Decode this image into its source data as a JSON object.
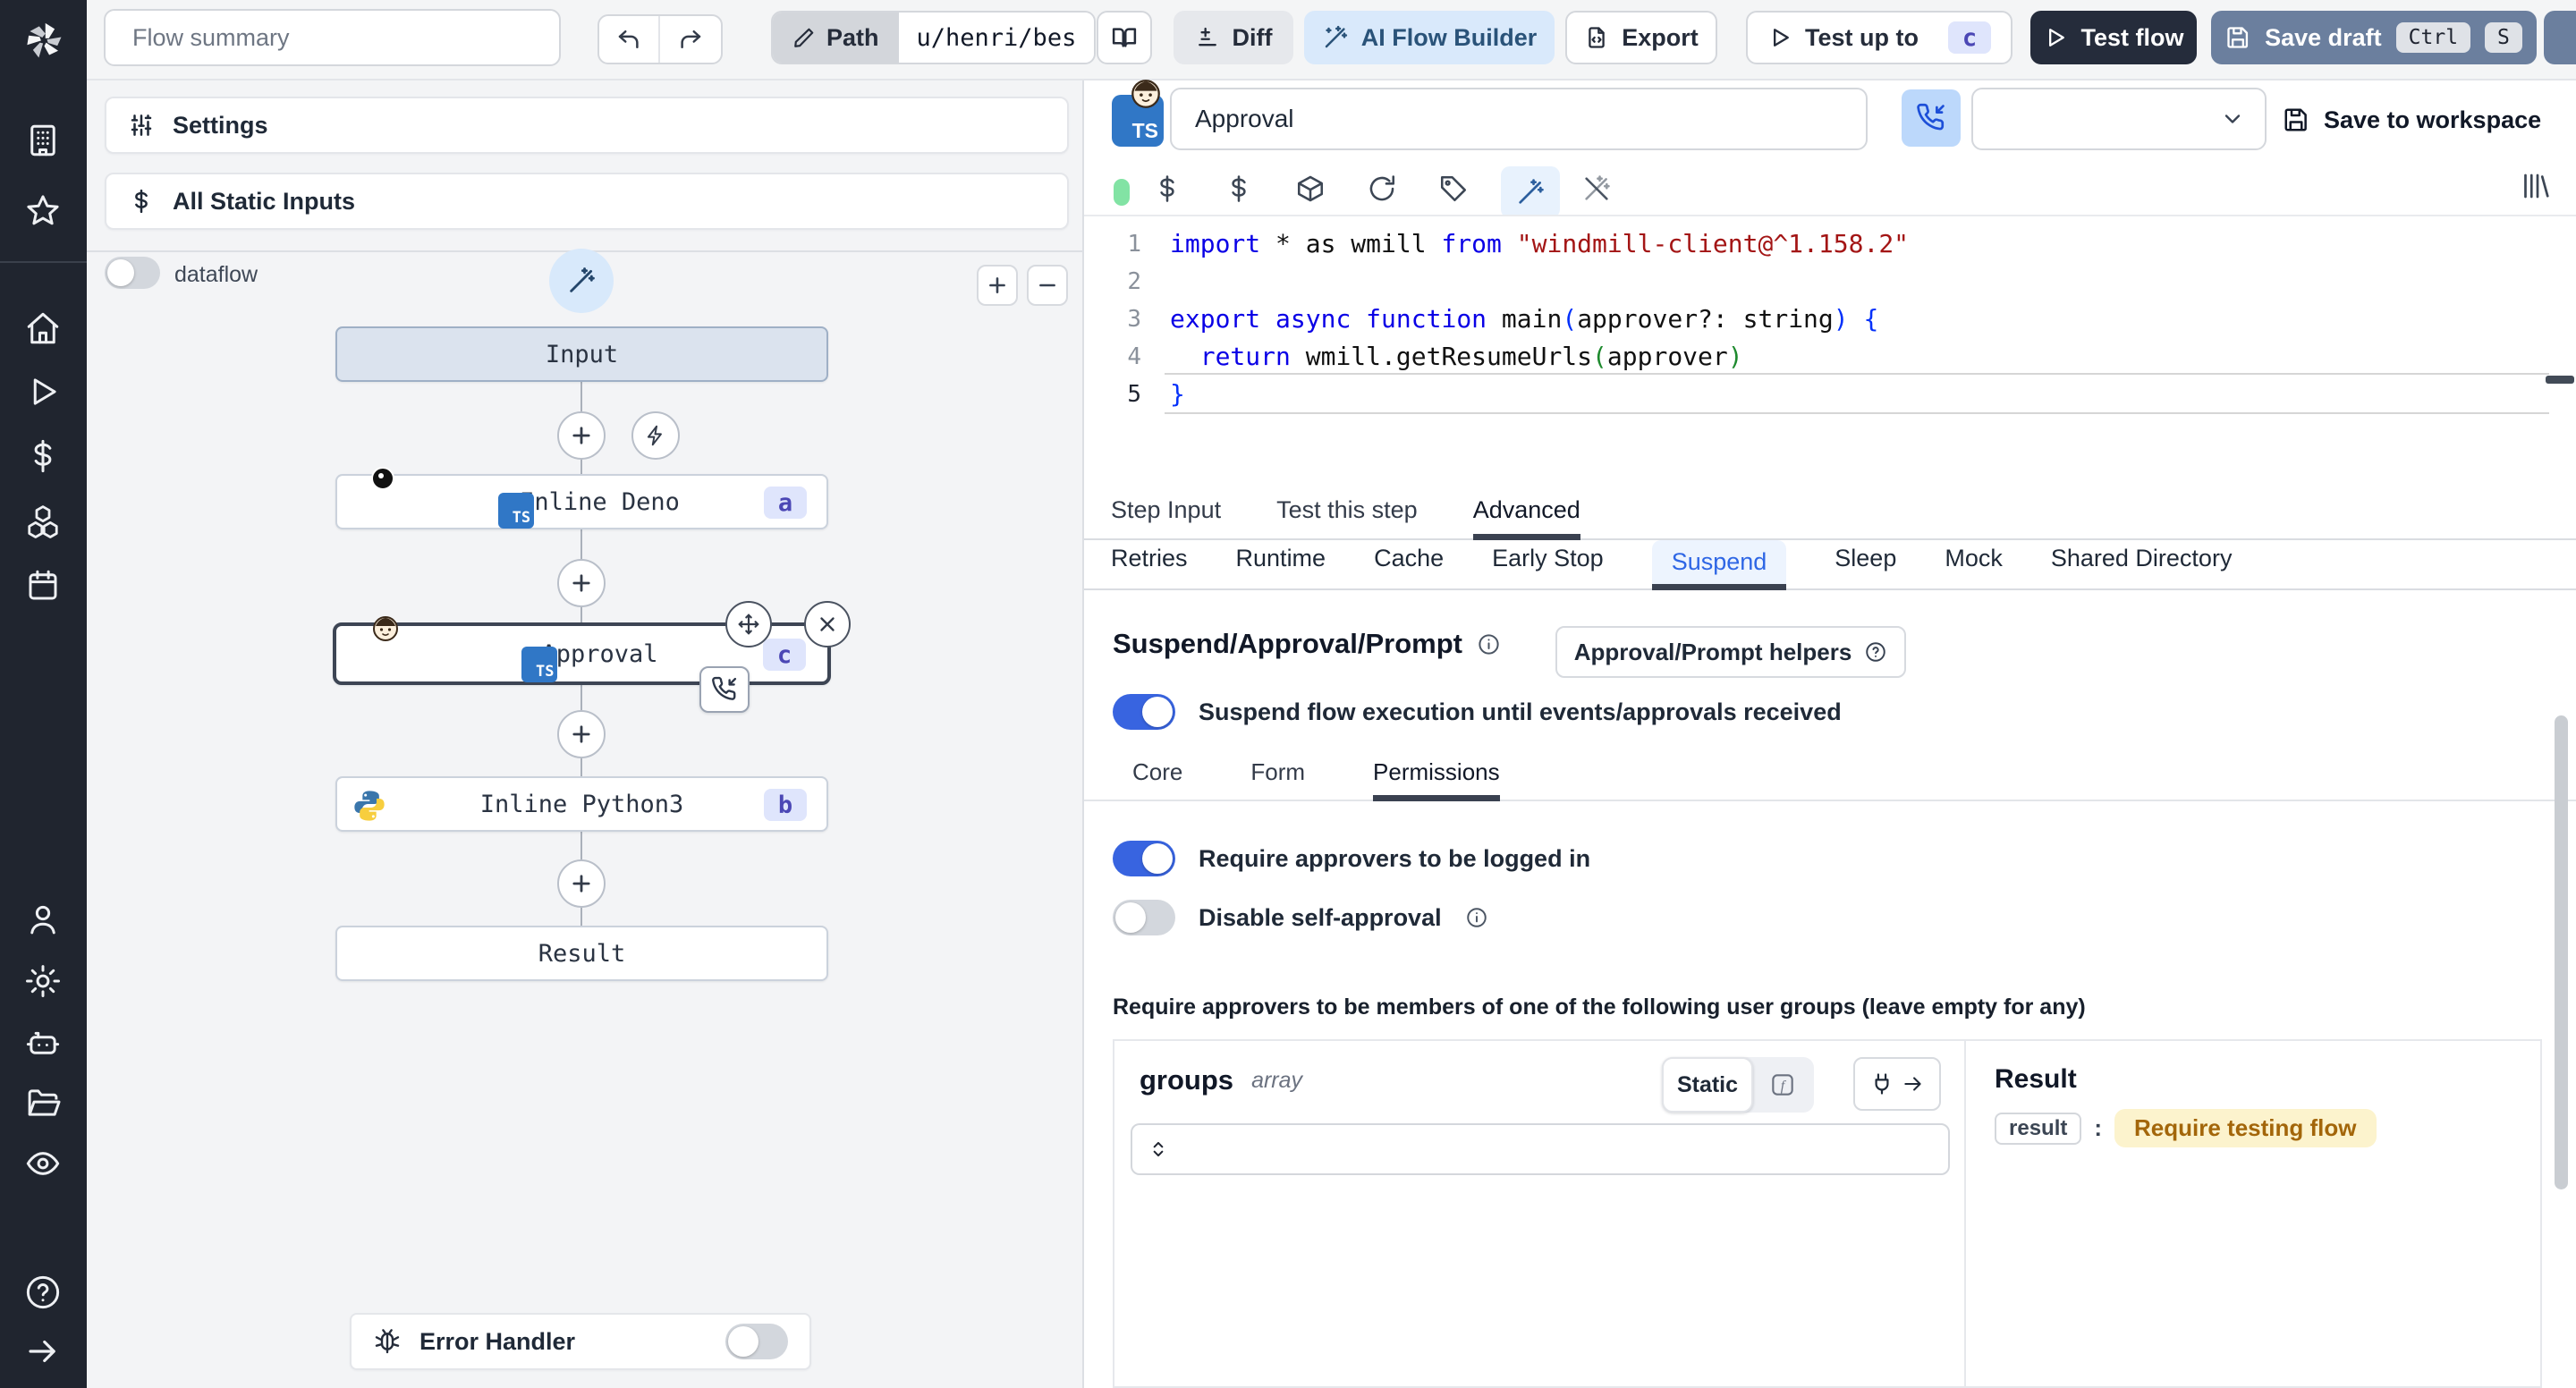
{
  "topbar": {
    "flow_summary_placeholder": "Flow summary",
    "path_label": "Path",
    "path_value": "u/henri/bes",
    "diff_label": "Diff",
    "ai_builder_label": "AI Flow Builder",
    "export_label": "Export",
    "test_up_to_label": "Test up to",
    "test_up_to_badge": "c",
    "test_flow_label": "Test flow",
    "save_draft_label": "Save draft",
    "save_kbd_1": "Ctrl",
    "save_kbd_2": "S"
  },
  "sidebar": {
    "icons": [
      "workspace",
      "favorites",
      "home",
      "runs",
      "variables",
      "resources",
      "schedules",
      "users",
      "settings",
      "workers",
      "folders",
      "audit-logs",
      "help",
      "expand"
    ]
  },
  "flow": {
    "settings_label": "Settings",
    "static_inputs_label": "All Static Inputs",
    "dataflow_label": "dataflow",
    "nodes": {
      "input": "Input",
      "deno": {
        "label": "Inline Deno",
        "badge": "a"
      },
      "approval": {
        "label": "Approval",
        "badge": "c"
      },
      "python": {
        "label": "Inline Python3",
        "badge": "b"
      },
      "result": "Result"
    },
    "error_handler_label": "Error Handler"
  },
  "step": {
    "title_value": "Approval",
    "save_to_workspace_label": "Save to workspace"
  },
  "editor": {
    "active_line": 5,
    "lines": [
      [
        [
          "kw",
          "import"
        ],
        [
          "pl",
          " * as wmill "
        ],
        [
          "kw",
          "from"
        ],
        [
          "pl",
          " "
        ],
        [
          "str",
          "\"windmill-client@^1.158.2\""
        ]
      ],
      [],
      [
        [
          "kw",
          "export"
        ],
        [
          "pl",
          " "
        ],
        [
          "kw",
          "async"
        ],
        [
          "pl",
          " "
        ],
        [
          "kw",
          "function"
        ],
        [
          "pl",
          " main"
        ],
        [
          "p1",
          "("
        ],
        [
          "pl",
          "approver?: string"
        ],
        [
          "p1",
          ")"
        ],
        [
          "pl",
          " "
        ],
        [
          "p1",
          "{"
        ]
      ],
      [
        [
          "pl",
          "  "
        ],
        [
          "kw",
          "return"
        ],
        [
          "pl",
          " wmill.getResumeUrls"
        ],
        [
          "p2",
          "("
        ],
        [
          "pl",
          "approver"
        ],
        [
          "p2",
          ")"
        ]
      ],
      [
        [
          "p1",
          "}"
        ]
      ]
    ]
  },
  "tabs": {
    "main": [
      "Step Input",
      "Test this step",
      "Advanced"
    ],
    "main_active": "Advanced",
    "advanced": [
      "Retries",
      "Runtime",
      "Cache",
      "Early Stop",
      "Suspend",
      "Sleep",
      "Mock",
      "Shared Directory"
    ],
    "advanced_active": "Suspend"
  },
  "suspend": {
    "heading": "Suspend/Approval/Prompt",
    "helpers_button": "Approval/Prompt helpers",
    "suspend_toggle_label": "Suspend flow execution until events/approvals received",
    "tabs": [
      "Core",
      "Form",
      "Permissions"
    ],
    "tabs_active": "Permissions",
    "require_login_label": "Require approvers to be logged in",
    "disable_self_label": "Disable self-approval",
    "groups_hint": "Require approvers to be members of one of the following user groups (leave empty for any)",
    "groups_label": "groups",
    "groups_type": "array",
    "static_label": "Static",
    "result_heading": "Result",
    "result_key": "result",
    "result_value": "Require testing flow"
  },
  "colors": {
    "accent_blue": "#3864e0",
    "sidebar_bg": "#20252f",
    "badge_bg": "#dfe5fc",
    "badge_text": "#4b47b5",
    "result_value_bg": "#fcf3cd",
    "result_value_text": "#a3660a",
    "save_draft_bg": "#6b7f9e",
    "test_flow_bg": "#252c3b",
    "ts_icon_bg": "#3077c6"
  }
}
